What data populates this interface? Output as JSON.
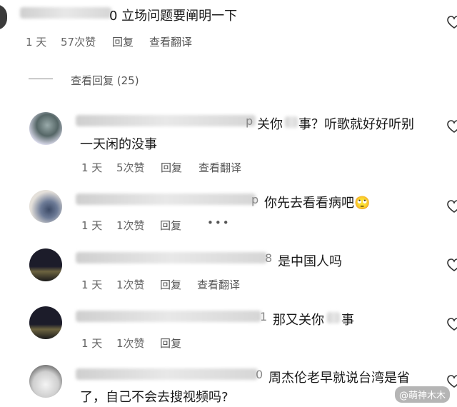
{
  "top_comment": {
    "text": "0 立场问题要阐明一下",
    "time": "1 天",
    "likes": "57次赞",
    "reply": "回复",
    "translate": "查看翻译"
  },
  "view_replies": "查看回复 (25)",
  "replies": [
    {
      "user_tail": "p",
      "text_line1": "关你",
      "text_line1b": "事？听歌就好好听别",
      "text_line2": "一天闲的没事",
      "time": "1 天",
      "likes": "5次赞",
      "reply": "回复",
      "translate": "查看翻译"
    },
    {
      "user_tail": "p",
      "text_line1": "你先去看看病吧🙄",
      "time": "1 天",
      "likes": "1次赞",
      "reply": "回复",
      "more": "•••"
    },
    {
      "user_tail": "8",
      "text_line1": "是中国人吗",
      "time": "1 天",
      "likes": "1次赞",
      "reply": "回复",
      "translate": "查看翻译"
    },
    {
      "user_tail": "1",
      "text_line1": "那又关你",
      "text_line1b": "事",
      "time": "1 天",
      "likes": "1次赞",
      "reply": "回复"
    },
    {
      "user_tail": "0",
      "text_line1": "周杰伦老早就说台湾是省",
      "text_line2": "了，自己不会去搜视频吗?"
    }
  ],
  "watermark": "@萌神木木"
}
